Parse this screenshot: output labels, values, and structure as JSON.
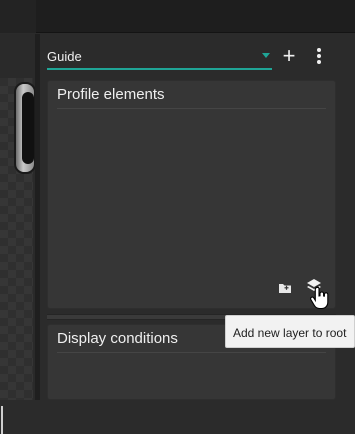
{
  "guide": {
    "selected_value": "Guide"
  },
  "panels": {
    "profile": {
      "title": "Profile elements"
    },
    "display": {
      "title": "Display conditions"
    }
  },
  "tooltip": {
    "text": "Add new layer to root"
  },
  "colors": {
    "accent": "#1fa596",
    "panel_bg": "#363636",
    "app_bg": "#2b2b2b",
    "tooltip_bg": "#f2f2f2"
  },
  "icons": [
    "plus-icon",
    "more-vertical-icon",
    "add-folder-icon",
    "add-layer-icon",
    "hand-cursor-icon",
    "dropdown-caret-icon"
  ]
}
